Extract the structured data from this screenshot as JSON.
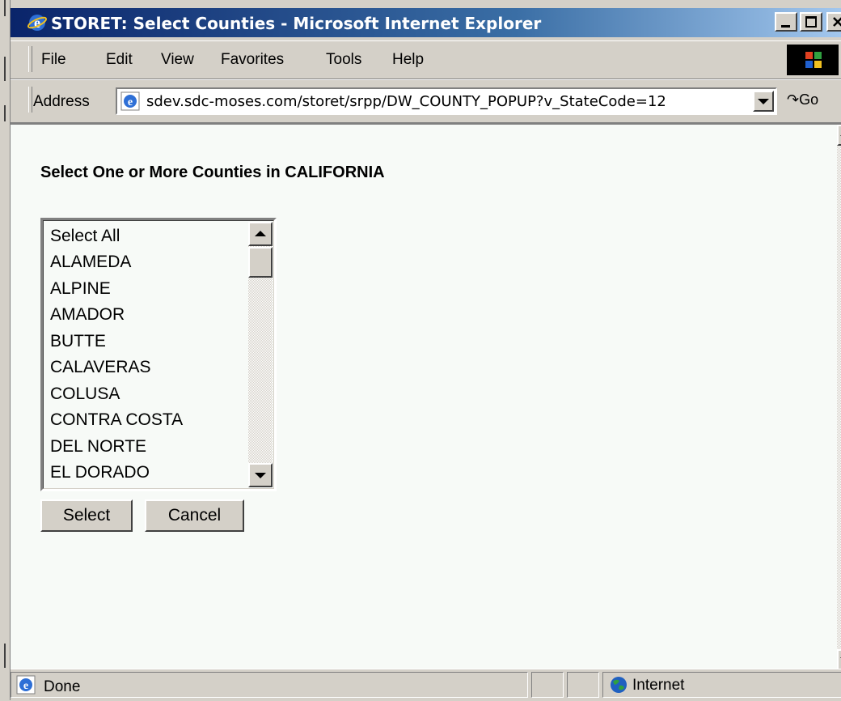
{
  "window": {
    "title": "STORET: Select Counties - Microsoft Internet Explorer"
  },
  "menu": {
    "items": [
      "File",
      "Edit",
      "View",
      "Favorites",
      "Tools",
      "Help"
    ]
  },
  "address": {
    "label": "Address",
    "url": "sdev.sdc-moses.com/storet/srpp/DW_COUNTY_POPUP?v_StateCode=12",
    "go_label": "Go"
  },
  "page": {
    "heading": "Select One or More Counties in CALIFORNIA",
    "counties": [
      "Select All",
      "ALAMEDA",
      "ALPINE",
      "AMADOR",
      "BUTTE",
      "CALAVERAS",
      "COLUSA",
      "CONTRA COSTA",
      "DEL NORTE",
      "EL DORADO"
    ],
    "select_label": "Select",
    "cancel_label": "Cancel"
  },
  "status": {
    "text": "Done",
    "zone": "Internet"
  },
  "icons": {
    "ie": "ie-logo-icon",
    "windows": "windows-logo-icon",
    "globe": "globe-icon"
  },
  "colors": {
    "titlebar": "#0a246a",
    "content_bg": "#f7faf7",
    "chrome": "#d4d0c8"
  }
}
